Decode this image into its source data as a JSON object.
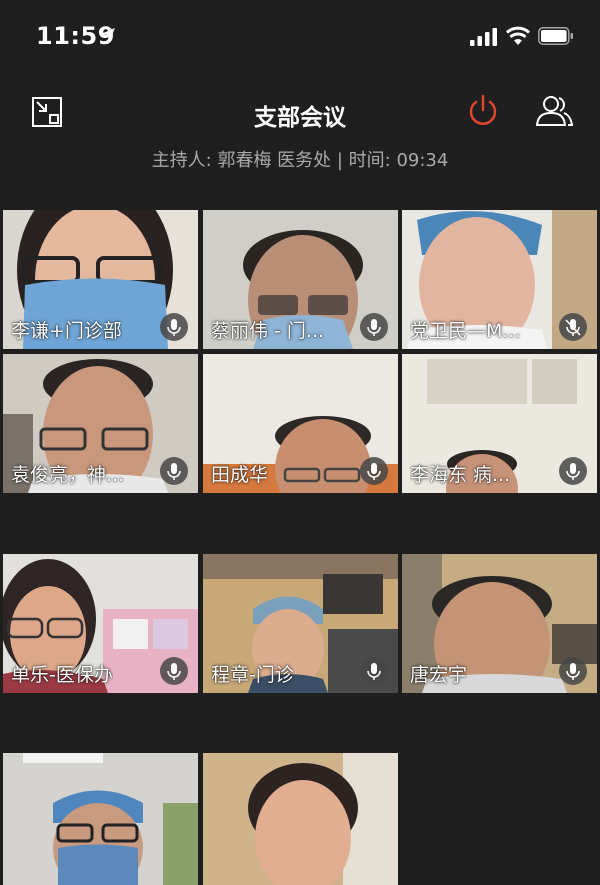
{
  "status_bar": {
    "time": "11:59"
  },
  "meeting": {
    "title": "支部会议",
    "host_line": "主持人: 郭春梅 医务处 | 时间: 09:34"
  },
  "participants": [
    {
      "name": "李谦+门诊部"
    },
    {
      "name": "蔡丽伟 - 门..."
    },
    {
      "name": "党卫民—M..."
    },
    {
      "name": "袁俊亮，神..."
    },
    {
      "name": "田成华"
    },
    {
      "name": "李海东 病..."
    },
    {
      "name": "单乐-医保办"
    },
    {
      "name": "程章-门诊"
    },
    {
      "name": "唐宏宇"
    },
    {
      "name": ""
    },
    {
      "name": ""
    }
  ],
  "icons": {
    "exit_fullscreen": "exit-fullscreen-icon",
    "end_meeting": "power-icon",
    "participants": "participants-icon",
    "mic": "microphone-icon"
  },
  "colors": {
    "background": "#1f1f1f",
    "end_meeting": "#e0452d",
    "subtitle": "#a9a9a9"
  }
}
